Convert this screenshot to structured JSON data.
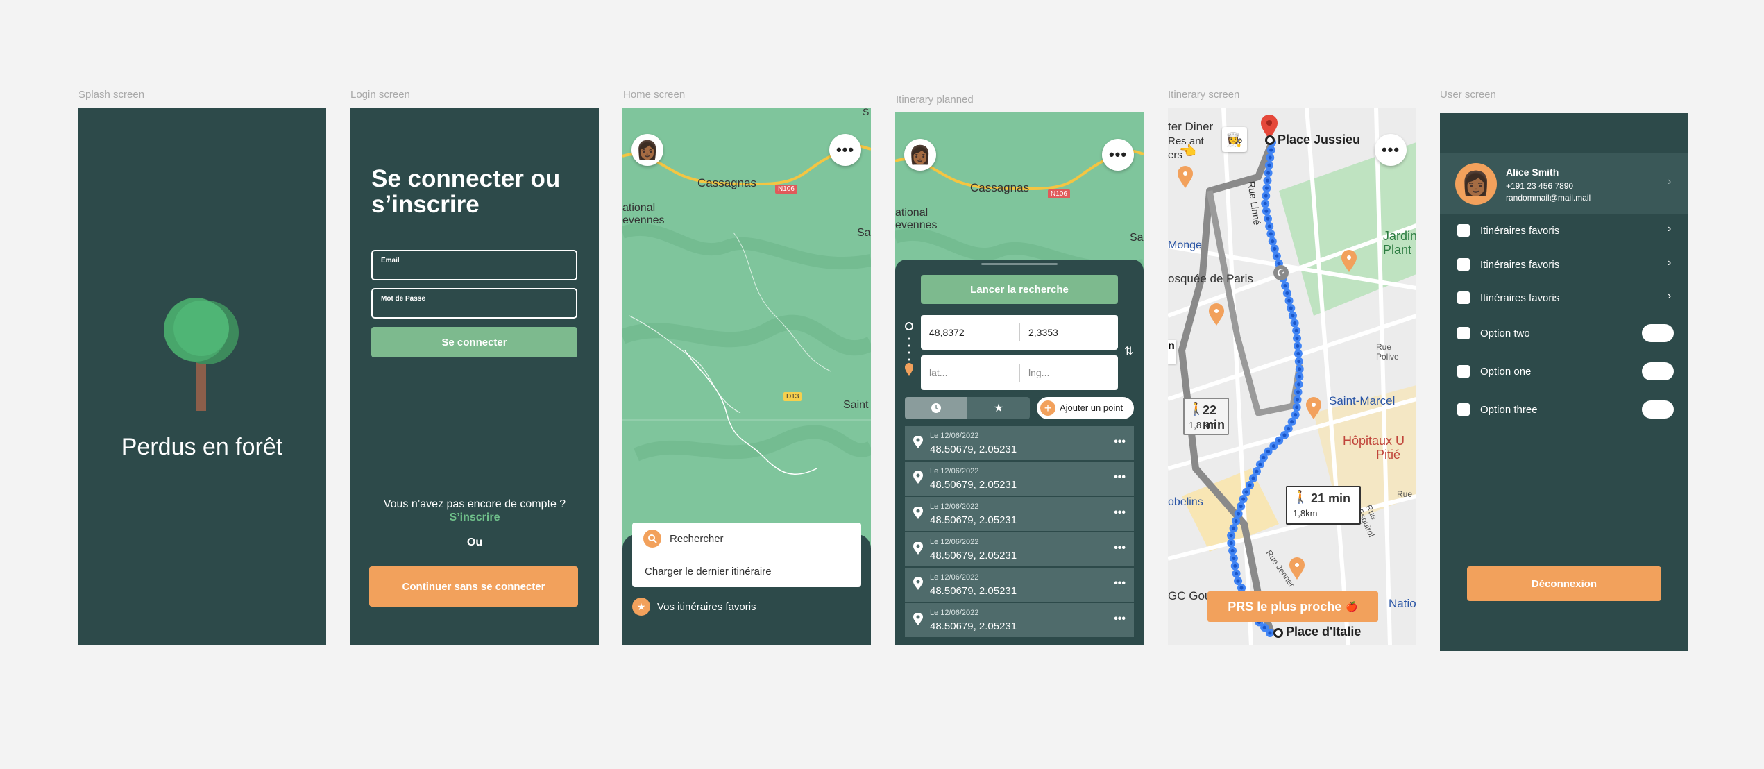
{
  "labels": {
    "splash": "Splash screen",
    "login": "Login screen",
    "home": "Home screen",
    "planned": "Itinerary planned",
    "itinerary": "Itinerary screen",
    "user": "User screen"
  },
  "splash": {
    "app_name": "Perdus en forêt"
  },
  "login": {
    "title_line1": "Se connecter ou",
    "title_line2": "s’inscrire",
    "email_label": "Email",
    "password_label": "Mot de Passe",
    "connect_button": "Se connecter",
    "no_account": "Vous n’avez pas encore de compte ?",
    "signup_link": "S’inscrire",
    "or": "Ou",
    "guest_button": "Continuer sans se connecter"
  },
  "map_labels": {
    "cassagnas": "Cassagnas",
    "n106": "N106",
    "d13": "D13",
    "national": "ational",
    "cevennes": "evennes",
    "sa": "Sa",
    "saint": "Saint",
    "s": "S"
  },
  "home": {
    "search_placeholder": "Rechercher",
    "load_last": "Charger le dernier itinéraire",
    "favorites": "Vos itinéraires favoris"
  },
  "planned": {
    "launch_button": "Lancer la recherche",
    "start_lat": "48,8372",
    "start_lng": "2,3353",
    "lat_placeholder": "lat...",
    "lng_placeholder": "lng...",
    "add_point": "Ajouter un point",
    "history": [
      {
        "date": "Le 12/06/2022",
        "coords": "48.50679, 2.05231"
      },
      {
        "date": "Le 12/06/2022",
        "coords": "48.50679, 2.05231"
      },
      {
        "date": "Le 12/06/2022",
        "coords": "48.50679, 2.05231"
      },
      {
        "date": "Le 12/06/2022",
        "coords": "48.50679, 2.05231"
      },
      {
        "date": "Le 12/06/2022",
        "coords": "48.50679, 2.05231"
      },
      {
        "date": "Le 12/06/2022",
        "coords": "48.50679, 2.05231"
      }
    ]
  },
  "itinerary": {
    "start": "Place Jussieu",
    "end": "Place d'Italie",
    "route_a_time": "22 min",
    "route_a_dist": "1,8 km",
    "route_b_time": "21 min",
    "route_b_dist": "1,8km",
    "nearest": "PRS le plus proche",
    "map_text": {
      "diner": "ter Diner",
      "rest1": "Res",
      "rest2": "ant",
      "rest3": "ers",
      "monge": "Monge",
      "mosquee": "osquée de Paris",
      "rue_linne": "Rue Linné",
      "jardin": "Jardin",
      "plant": "Plant",
      "rue_police": "Rue Polive",
      "saint_marcel": "Saint-Marcel",
      "hopitaux": "Hôpitaux U",
      "pitie": "Pitié",
      "gobelins": "obelins",
      "rue_esquirol": "Rue Esquirol",
      "rue_jenner": "Rue Jenner",
      "gc_gour": "GC Gour",
      "natio": "Natio",
      "rue": "Rue",
      "n": "n"
    }
  },
  "user": {
    "name": "Alice Smith",
    "phone": "+191 23 456 7890",
    "email": "randommail@mail.mail",
    "menu": [
      "Itinéraires favoris",
      "Itinéraires favoris",
      "Itinéraires favoris"
    ],
    "options": [
      "Option two",
      "Option one",
      "Option three"
    ],
    "logout": "Déconnexion"
  },
  "colors": {
    "dark_green": "#2d4a4a",
    "accent_orange": "#f2a15c",
    "light_green": "#7dba8e",
    "route_blue": "#4285f4"
  }
}
